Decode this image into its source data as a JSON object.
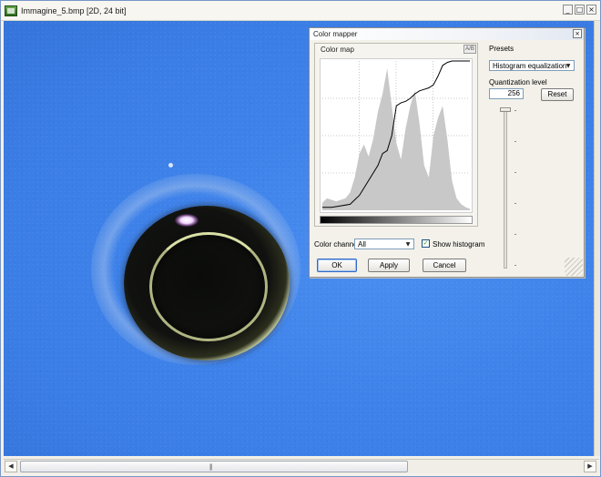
{
  "window": {
    "title": "Immagine_5.bmp [2D, 24 bit]",
    "minimize": "_",
    "maximize": "□",
    "close": "×"
  },
  "scrollbar": {
    "left": "◀",
    "right": "▶",
    "grip": "|||"
  },
  "dialog": {
    "title": "Color mapper",
    "close": "×",
    "colormap_label": "Color map",
    "ab_button": "A/B",
    "color_channel_label": "Color channel",
    "color_channel_value": "All",
    "show_histogram_label": "Show histogram",
    "show_histogram_checked": true,
    "ok": "OK",
    "apply": "Apply",
    "cancel": "Cancel",
    "presets_label": "Presets",
    "presets_value": "Histogram equalization",
    "cutoff_label": "Quantization level",
    "cutoff_value": "256",
    "reset": "Reset"
  },
  "chart_data": {
    "type": "area",
    "title": "",
    "xlabel": "",
    "ylabel": "",
    "xlim": [
      0,
      255
    ],
    "ylim": [
      0,
      100
    ],
    "grid": true,
    "series": [
      {
        "type": "area",
        "color": "#c8c8c8",
        "x": [
          0,
          8,
          16,
          24,
          32,
          40,
          48,
          56,
          64,
          72,
          80,
          88,
          96,
          104,
          112,
          120,
          128,
          136,
          144,
          152,
          160,
          168,
          176,
          184,
          192,
          200,
          208,
          216,
          224,
          232,
          240,
          248,
          255
        ],
        "values": [
          5,
          8,
          7,
          6,
          7,
          8,
          12,
          22,
          38,
          44,
          36,
          48,
          66,
          78,
          95,
          70,
          45,
          34,
          55,
          70,
          80,
          58,
          30,
          22,
          50,
          62,
          70,
          48,
          20,
          8,
          4,
          2,
          1
        ]
      },
      {
        "type": "line",
        "color": "#000000",
        "x": [
          0,
          16,
          32,
          48,
          64,
          80,
          96,
          104,
          112,
          120,
          128,
          136,
          144,
          152,
          160,
          168,
          176,
          184,
          192,
          200,
          208,
          216,
          224,
          232,
          240,
          255
        ],
        "values": [
          2,
          2,
          3,
          4,
          10,
          20,
          30,
          38,
          40,
          50,
          70,
          72,
          73,
          75,
          78,
          80,
          81,
          82,
          84,
          90,
          97,
          99,
          100,
          100,
          100,
          100
        ]
      }
    ]
  },
  "colors": {
    "image_blue": "#3f83ea",
    "dialog_bg": "#f3f1ea",
    "histogram_fill": "#c8c8c8"
  }
}
